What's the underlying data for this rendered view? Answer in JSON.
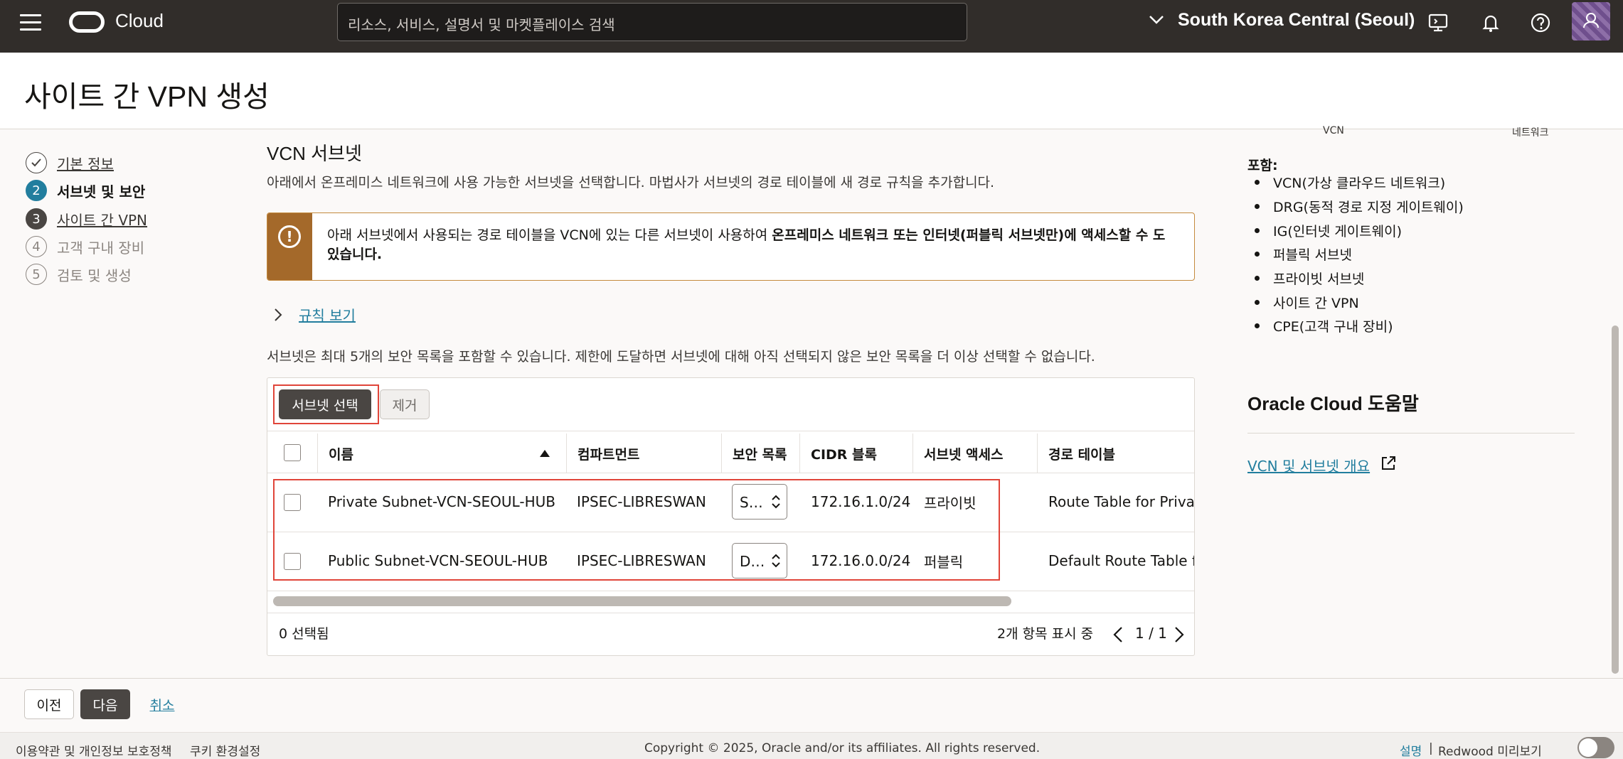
{
  "topbar": {
    "brand": "Cloud",
    "search_placeholder": "리소스, 서비스, 설명서 및 마켓플레이스 검색",
    "region": "South Korea Central (Seoul)"
  },
  "page": {
    "title": "사이트 간 VPN 생성"
  },
  "steps": [
    {
      "num": "",
      "label": "기본 정보"
    },
    {
      "num": "2",
      "label": "서브넷 및 보안"
    },
    {
      "num": "3",
      "label": "사이트 간 VPN"
    },
    {
      "num": "4",
      "label": "고객 구내 장비"
    },
    {
      "num": "5",
      "label": "검토 및 생성"
    }
  ],
  "main": {
    "section_title": "VCN 서브넷",
    "description": "아래에서 온프레미스 네트워크에 사용 가능한 서브넷을 선택합니다. 마법사가 서브넷의 경로 테이블에 새 경로 규칙을 추가합니다.",
    "warning_plain": "아래 서브넷에서 사용되는 경로 테이블을 VCN에 있는 다른 서브넷이 사용하여 ",
    "warning_bold": "온프레미스 네트워크 또는 인터넷(퍼블릭 서브넷만)에 액세스할 수 도 있습니다.",
    "rules_toggle": "규칙 보기",
    "limit_text": "서브넷은 최대 5개의 보안 목록을 포함할 수 있습니다. 제한에 도달하면 서브넷에 대해 아직 선택되지 않은 보안 목록을 더 이상 선택할 수 없습니다.",
    "select_subnet_button": "서브넷 선택",
    "remove_button": "제거",
    "table": {
      "columns": [
        "이름",
        "컴파트먼트",
        "보안 목록",
        "CIDR 블록",
        "서브넷 액세스",
        "경로 테이블"
      ],
      "rows": [
        {
          "name": "Private Subnet-VCN-SEOUL-HUB",
          "compartment": "IPSEC-LIBRESWAN",
          "security_list": "S…",
          "cidr": "172.16.1.0/24",
          "access": "프라이빗",
          "route_table": "Route Table for Private"
        },
        {
          "name": "Public Subnet-VCN-SEOUL-HUB",
          "compartment": "IPSEC-LIBRESWAN",
          "security_list": "D…",
          "cidr": "172.16.0.0/24",
          "access": "퍼블릭",
          "route_table": "Default Route Table fo"
        }
      ],
      "selected_count": "0 선택됨",
      "items_shown": "2개 항목 표시 중",
      "page": "1 / 1"
    }
  },
  "side": {
    "diagram_labels": [
      "VCN",
      "네트워크"
    ],
    "includes_title": "포함:",
    "includes": [
      "VCN(가상 클라우드 네트워크)",
      "DRG(동적 경로 지정 게이트웨이)",
      "IG(인터넷 게이트웨이)",
      "퍼블릭 서브넷",
      "프라이빗 서브넷",
      "사이트 간 VPN",
      "CPE(고객 구내 장비)"
    ],
    "help_title": "Oracle Cloud 도움말",
    "help_link": "VCN 및 서브넷 개요"
  },
  "footer": {
    "prev": "이전",
    "next": "다음",
    "cancel": "취소",
    "terms": "이용약관 및 개인정보 보호정책",
    "cookies": "쿠키 환경설정",
    "copyright": "Copyright © 2025, Oracle and/or its affiliates. All rights reserved.",
    "docs": "설명",
    "separator": "|",
    "redwood": "Redwood 미리보기"
  }
}
